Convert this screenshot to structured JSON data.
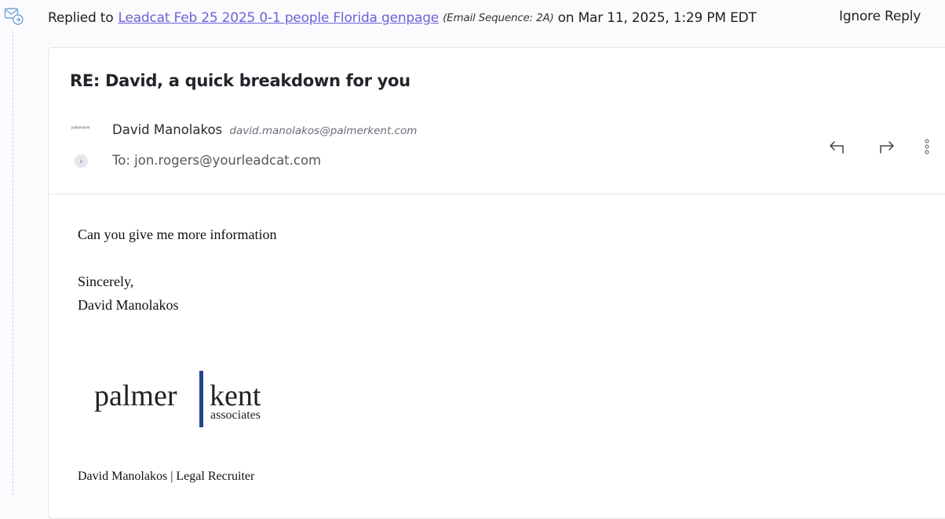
{
  "event": {
    "prefix": "Replied to",
    "link": "Leadcat Feb 25 2025 0-1 people Florida genpage",
    "sequence": "(Email Sequence: 2A)",
    "timestamp": "on Mar 11, 2025, 1:29 PM EDT",
    "ignore_label": "Ignore Reply"
  },
  "email": {
    "subject": "RE: David, a quick breakdown for you",
    "from_name": "David Manolakos",
    "from_email": "david.manolakos@palmerkent.com",
    "small_logo_text": "palmer|kent",
    "to": "To: jon.rogers@yourleadcat.com",
    "icons": [
      "reply-icon",
      "forward-icon",
      "more-vertical-icon",
      "chevron-right-icon"
    ]
  },
  "body": {
    "line1": "Can you give me more information",
    "closing": "Sincerely,",
    "signoff": "David Manolakos",
    "logo": {
      "left": "palmer",
      "right": "kent",
      "sub": "associates"
    },
    "signature": "David Manolakos | Legal Recruiter"
  },
  "colors": {
    "link": "#6c63d9",
    "logo_bar": "#27438d",
    "timeline": "#c9c7e8"
  }
}
